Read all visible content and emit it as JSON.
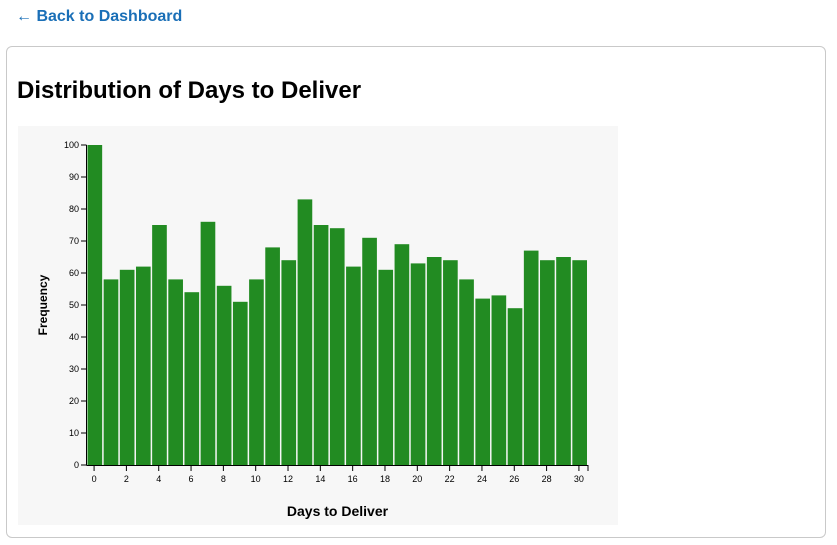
{
  "nav": {
    "back_label": "← Back to Dashboard"
  },
  "page": {
    "title": "Distribution of Days to Deliver"
  },
  "colors": {
    "bar": "#228b22",
    "link": "#1a6fb7",
    "panel": "#f7f7f7"
  },
  "chart_data": {
    "type": "bar",
    "xlabel": "Days to Deliver",
    "ylabel": "Frequency",
    "x": [
      0,
      1,
      2,
      3,
      4,
      5,
      6,
      7,
      8,
      9,
      10,
      11,
      12,
      13,
      14,
      15,
      16,
      17,
      18,
      19,
      20,
      21,
      22,
      23,
      24,
      25,
      26,
      27,
      28,
      29,
      30
    ],
    "values": [
      100,
      58,
      61,
      62,
      75,
      58,
      54,
      76,
      56,
      51,
      58,
      68,
      64,
      83,
      75,
      74,
      62,
      71,
      61,
      69,
      63,
      65,
      64,
      58,
      52,
      53,
      49,
      67,
      64,
      65,
      64
    ],
    "xticks": [
      0,
      2,
      4,
      6,
      8,
      10,
      12,
      14,
      16,
      18,
      20,
      22,
      24,
      26,
      28,
      30
    ],
    "yticks": [
      0,
      10,
      20,
      30,
      40,
      50,
      60,
      70,
      80,
      90,
      100
    ],
    "ylim": [
      0,
      100
    ],
    "grid": false,
    "legend": "none"
  }
}
